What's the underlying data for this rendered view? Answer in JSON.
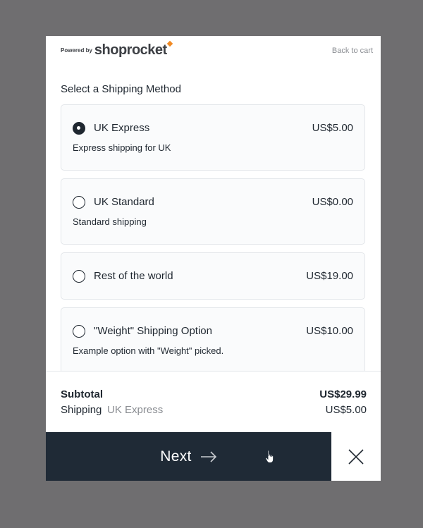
{
  "header": {
    "powered_by": "Powered by",
    "brand": "shoprocket",
    "back_link": "Back to cart"
  },
  "section_title": "Select a Shipping Method",
  "methods": [
    {
      "name": "UK Express",
      "price": "US$5.00",
      "description": "Express shipping for UK",
      "selected": true
    },
    {
      "name": "UK Standard",
      "price": "US$0.00",
      "description": "Standard shipping",
      "selected": false
    },
    {
      "name": "Rest of the world",
      "price": "US$19.00",
      "description": "",
      "selected": false
    },
    {
      "name": "\"Weight\" Shipping Option",
      "price": "US$10.00",
      "description": "Example option with \"Weight\" picked.",
      "selected": false
    }
  ],
  "summary": {
    "subtotal_label": "Subtotal",
    "subtotal_value": "US$29.99",
    "shipping_label": "Shipping",
    "shipping_method": "UK Express",
    "shipping_value": "US$5.00"
  },
  "footer": {
    "next_label": "Next"
  },
  "icons": {
    "next": "arrow-right-icon",
    "close": "close-icon",
    "cursor": "hand-pointer-icon",
    "logo": "rocket-flame-icon"
  },
  "colors": {
    "backdrop": "#6f6e70",
    "primary_dark": "#1f2a36",
    "accent": "#f08a24",
    "muted_text": "#8a8d92"
  }
}
